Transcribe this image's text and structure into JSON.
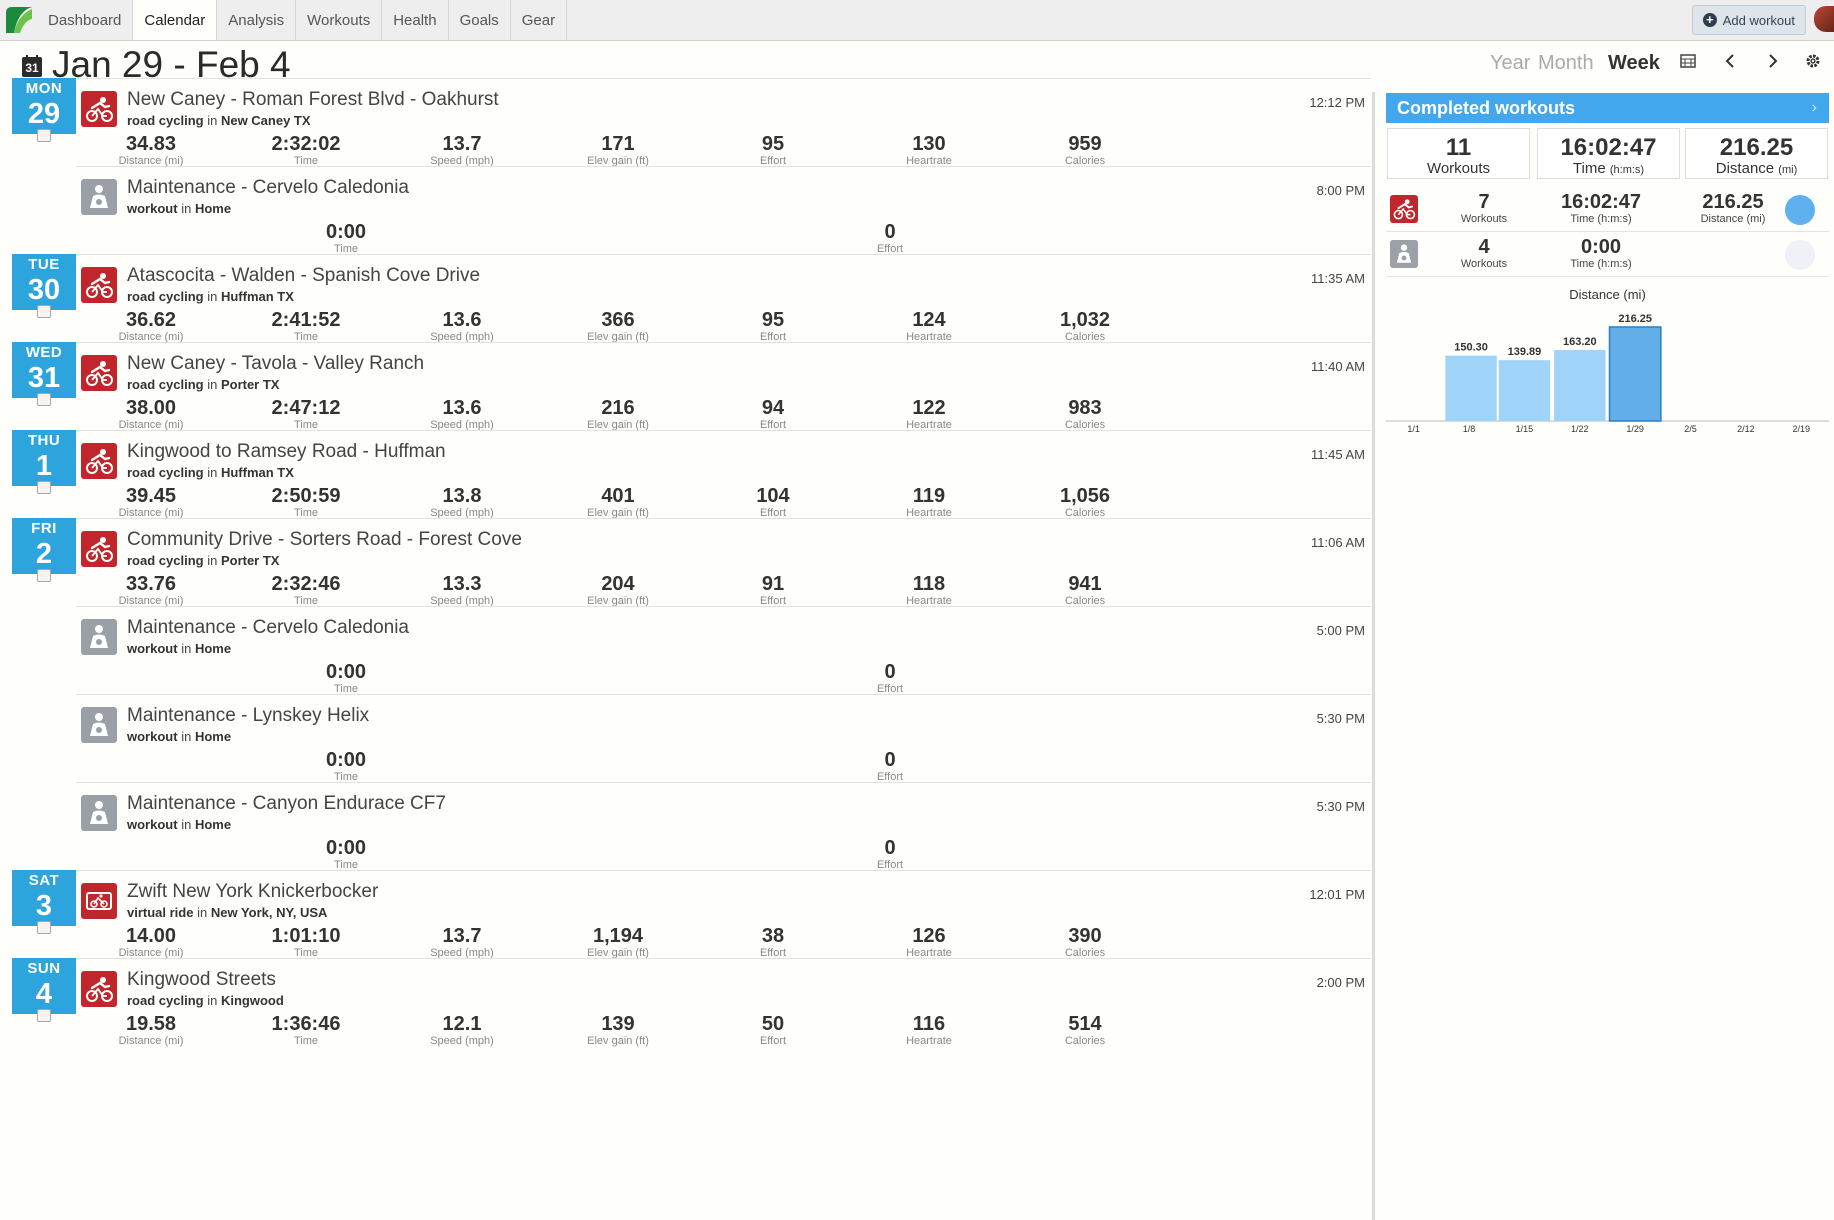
{
  "nav": {
    "tabs": [
      "Dashboard",
      "Calendar",
      "Analysis",
      "Workouts",
      "Health",
      "Goals",
      "Gear"
    ],
    "active": "Calendar",
    "add_workout": "Add workout"
  },
  "header": {
    "calendar_icon_text": "31",
    "title": "Jan 29 - Feb 4",
    "periods": [
      "Year",
      "Month",
      "Week"
    ],
    "active_period": "Week"
  },
  "days": [
    {
      "name": "MON",
      "date": "29"
    },
    {
      "name": "TUE",
      "date": "30"
    },
    {
      "name": "WED",
      "date": "31"
    },
    {
      "name": "THU",
      "date": "1"
    },
    {
      "name": "FRI",
      "date": "2"
    },
    {
      "name": "SAT",
      "date": "3"
    },
    {
      "name": "SUN",
      "date": "4"
    }
  ],
  "labels": {
    "distance": "Distance (mi)",
    "time": "Time",
    "speed": "Speed (mph)",
    "elev": "Elev gain (ft)",
    "effort": "Effort",
    "heartrate": "Heartrate",
    "calories": "Calories",
    "in": "in"
  },
  "workouts": [
    {
      "type": "road cycling",
      "icon": "cycling-icon",
      "title": "New Caney - Roman Forest Blvd - Oakhurst",
      "location": "New Caney TX",
      "time": "12:12 PM",
      "distance": "34.83",
      "duration": "2:32:02",
      "speed": "13.7",
      "elev": "171",
      "effort": "95",
      "heartrate": "130",
      "calories": "959"
    },
    {
      "type": "workout",
      "icon": "maintenance-icon",
      "title": "Maintenance - Cervelo Caledonia",
      "location": "Home",
      "time": "8:00 PM",
      "duration": "0:00",
      "effort": "0"
    },
    {
      "type": "road cycling",
      "icon": "cycling-icon",
      "title": "Atascocita - Walden - Spanish Cove Drive",
      "location": "Huffman TX",
      "time": "11:35 AM",
      "distance": "36.62",
      "duration": "2:41:52",
      "speed": "13.6",
      "elev": "366",
      "effort": "95",
      "heartrate": "124",
      "calories": "1,032"
    },
    {
      "type": "road cycling",
      "icon": "cycling-icon",
      "title": "New Caney - Tavola - Valley Ranch",
      "location": "Porter TX",
      "time": "11:40 AM",
      "distance": "38.00",
      "duration": "2:47:12",
      "speed": "13.6",
      "elev": "216",
      "effort": "94",
      "heartrate": "122",
      "calories": "983"
    },
    {
      "type": "road cycling",
      "icon": "cycling-icon",
      "title": "Kingwood to Ramsey Road - Huffman",
      "location": "Huffman TX",
      "time": "11:45 AM",
      "distance": "39.45",
      "duration": "2:50:59",
      "speed": "13.8",
      "elev": "401",
      "effort": "104",
      "heartrate": "119",
      "calories": "1,056"
    },
    {
      "type": "road cycling",
      "icon": "cycling-icon",
      "title": "Community Drive - Sorters Road - Forest Cove",
      "location": "Porter TX",
      "time": "11:06 AM",
      "distance": "33.76",
      "duration": "2:32:46",
      "speed": "13.3",
      "elev": "204",
      "effort": "91",
      "heartrate": "118",
      "calories": "941"
    },
    {
      "type": "workout",
      "icon": "maintenance-icon",
      "title": "Maintenance - Cervelo Caledonia",
      "location": "Home",
      "time": "5:00 PM",
      "duration": "0:00",
      "effort": "0"
    },
    {
      "type": "workout",
      "icon": "maintenance-icon",
      "title": "Maintenance - Lynskey Helix",
      "location": "Home",
      "time": "5:30 PM",
      "duration": "0:00",
      "effort": "0"
    },
    {
      "type": "workout",
      "icon": "maintenance-icon",
      "title": "Maintenance - Canyon Endurace CF7",
      "location": "Home",
      "time": "5:30 PM",
      "duration": "0:00",
      "effort": "0"
    },
    {
      "type": "virtual ride",
      "icon": "virtual-ride-icon",
      "title": "Zwift New York Knickerbocker",
      "location": "New York, NY, USA",
      "time": "12:01 PM",
      "distance": "14.00",
      "duration": "1:01:10",
      "speed": "13.7",
      "elev": "1,194",
      "effort": "38",
      "heartrate": "126",
      "calories": "390"
    },
    {
      "type": "road cycling",
      "icon": "cycling-icon",
      "title": "Kingwood Streets",
      "location": "Kingwood",
      "time": "2:00 PM",
      "distance": "19.58",
      "duration": "1:36:46",
      "speed": "12.1",
      "elev": "139",
      "effort": "50",
      "heartrate": "116",
      "calories": "514"
    }
  ],
  "summary": {
    "title": "Completed workouts",
    "workouts": "11",
    "workouts_label": "Workouts",
    "time": "16:02:47",
    "time_label": "Time",
    "time_unit": "(h:m:s)",
    "distance": "216.25",
    "distance_label": "Distance",
    "distance_unit": "(mi)",
    "by_type": [
      {
        "icon": "cycling-icon",
        "workouts": "7",
        "workouts_label": "Workouts",
        "time": "16:02:47",
        "time_label": "Time (h:m:s)",
        "distance": "216.25",
        "distance_label": "Distance (mi)",
        "color": "#5fb0ee"
      },
      {
        "icon": "maintenance-icon",
        "workouts": "4",
        "workouts_label": "Workouts",
        "time": "0:00",
        "time_label": "Time (h:m:s)",
        "color": "#eef2f6"
      }
    ]
  },
  "chart_data": {
    "type": "bar",
    "title": "Distance (mi)",
    "categories": [
      "1/1",
      "1/8",
      "1/15",
      "1/22",
      "1/29",
      "2/5",
      "2/12",
      "2/19"
    ],
    "values": [
      null,
      150.3,
      139.89,
      163.2,
      216.25,
      null,
      null,
      null
    ],
    "value_labels": [
      "",
      "150.30",
      "139.89",
      "163.20",
      "216.25",
      "",
      "",
      ""
    ],
    "highlight_index": 4,
    "colors": {
      "bar": "#9fd3f7",
      "highlight": "#62aee8",
      "highlight_border": "#2b7fc4"
    },
    "ylim": [
      0,
      230
    ]
  }
}
